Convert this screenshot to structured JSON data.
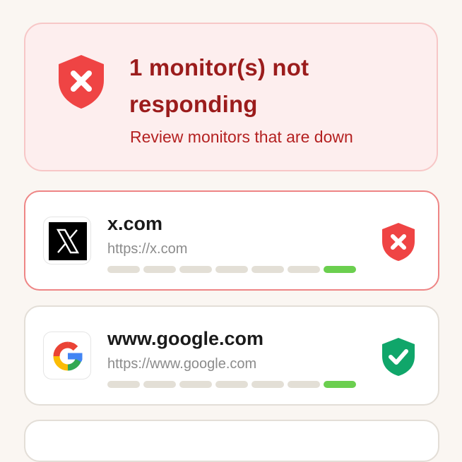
{
  "alert": {
    "title": "1 monitor(s) not responding",
    "subtitle": "Review monitors that are down",
    "icon": "shield-x-icon",
    "color": "#ef4444"
  },
  "monitors": [
    {
      "name": "x.com",
      "url": "https://x.com",
      "status": "down",
      "status_icon": "shield-x-icon",
      "logo": "x-logo-icon",
      "history": [
        "unknown",
        "unknown",
        "unknown",
        "unknown",
        "unknown",
        "unknown",
        "up"
      ]
    },
    {
      "name": "www.google.com",
      "url": "https://www.google.com",
      "status": "up",
      "status_icon": "shield-check-icon",
      "logo": "google-logo-icon",
      "history": [
        "unknown",
        "unknown",
        "unknown",
        "unknown",
        "unknown",
        "unknown",
        "up"
      ]
    }
  ],
  "colors": {
    "down": "#ef4444",
    "up": "#10a66a",
    "history_up": "#6bcf4f",
    "history_unknown": "#e3dfd6"
  }
}
